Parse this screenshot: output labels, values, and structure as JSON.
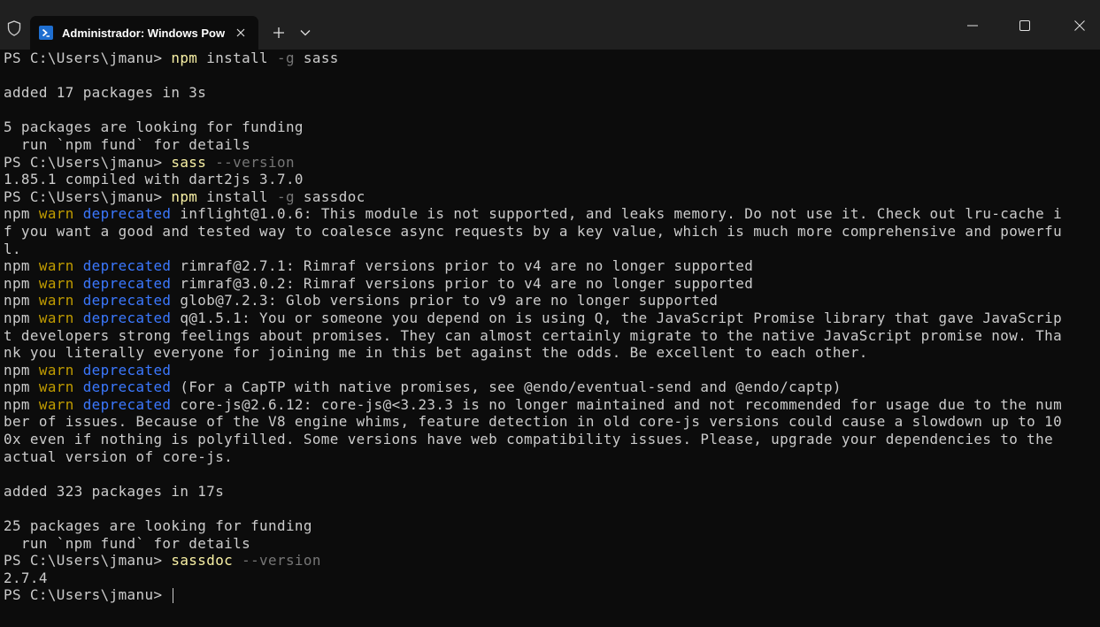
{
  "window": {
    "tab_title": "Administrador: Windows Pow",
    "icons": {
      "shield": "shield-icon",
      "tab": "powershell-icon",
      "close_tab": "close-icon",
      "new_tab": "plus-icon",
      "dropdown": "chevron-down-icon",
      "minimize": "minimize-icon",
      "maximize": "maximize-icon",
      "close_window": "close-icon"
    }
  },
  "colors": {
    "background": "#0c0c0c",
    "text": "#cccccc",
    "command": "#f9f1a5",
    "param": "#767676",
    "warn": "#c19c00",
    "deprecated": "#3b78ff",
    "titlebar": "#202020"
  },
  "terminal": {
    "prompt": "PS C:\\Users\\jmanu> ",
    "commands": [
      {
        "cmd": "npm",
        "rest1": " install ",
        "param": "-g",
        "rest2": " sass"
      },
      {
        "cmd": "sass",
        "param": "--version"
      },
      {
        "cmd": "npm",
        "rest1": " install ",
        "param": "-g",
        "rest2": " sassdoc"
      },
      {
        "cmd": "sassdoc",
        "param": "--version"
      }
    ],
    "npm_label": "npm",
    "warn_label": "warn",
    "deprecated_label": "deprecated",
    "lines": {
      "added1": "added 17 packages in 3s",
      "funding1": "5 packages are looking for funding",
      "fund_cmd1": "  run `npm fund` for details",
      "sass_version": "1.85.1 compiled with dart2js 3.7.0",
      "inflight_1": " inflight@1.0.6: This module is not supported, and leaks memory. Do not use it. Check out lru-cache i",
      "inflight_2": "f you want a good and tested way to coalesce async requests by a key value, which is much more comprehensive and powerfu",
      "inflight_3": "l.",
      "rimraf1": " rimraf@2.7.1: Rimraf versions prior to v4 are no longer supported",
      "rimraf2": " rimraf@3.0.2: Rimraf versions prior to v4 are no longer supported",
      "glob": " glob@7.2.3: Glob versions prior to v9 are no longer supported",
      "q_1": " q@1.5.1: You or someone you depend on is using Q, the JavaScript Promise library that gave JavaScrip",
      "q_2": "t developers strong feelings about promises. They can almost certainly migrate to the native JavaScript promise now. Tha",
      "q_3": "nk you literally everyone for joining me in this bet against the odds. Be excellent to each other.",
      "captp": " (For a CapTP with native promises, see @endo/eventual-send and @endo/captp)",
      "corejs_1": " core-js@2.6.12: core-js@<3.23.3 is no longer maintained and not recommended for usage due to the num",
      "corejs_2": "ber of issues. Because of the V8 engine whims, feature detection in old core-js versions could cause a slowdown up to 10",
      "corejs_3": "0x even if nothing is polyfilled. Some versions have web compatibility issues. Please, upgrade your dependencies to the",
      "corejs_4": "actual version of core-js.",
      "added2": "added 323 packages in 17s",
      "funding2": "25 packages are looking for funding",
      "fund_cmd2": "  run `npm fund` for details",
      "sassdoc_version": "2.7.4"
    }
  }
}
